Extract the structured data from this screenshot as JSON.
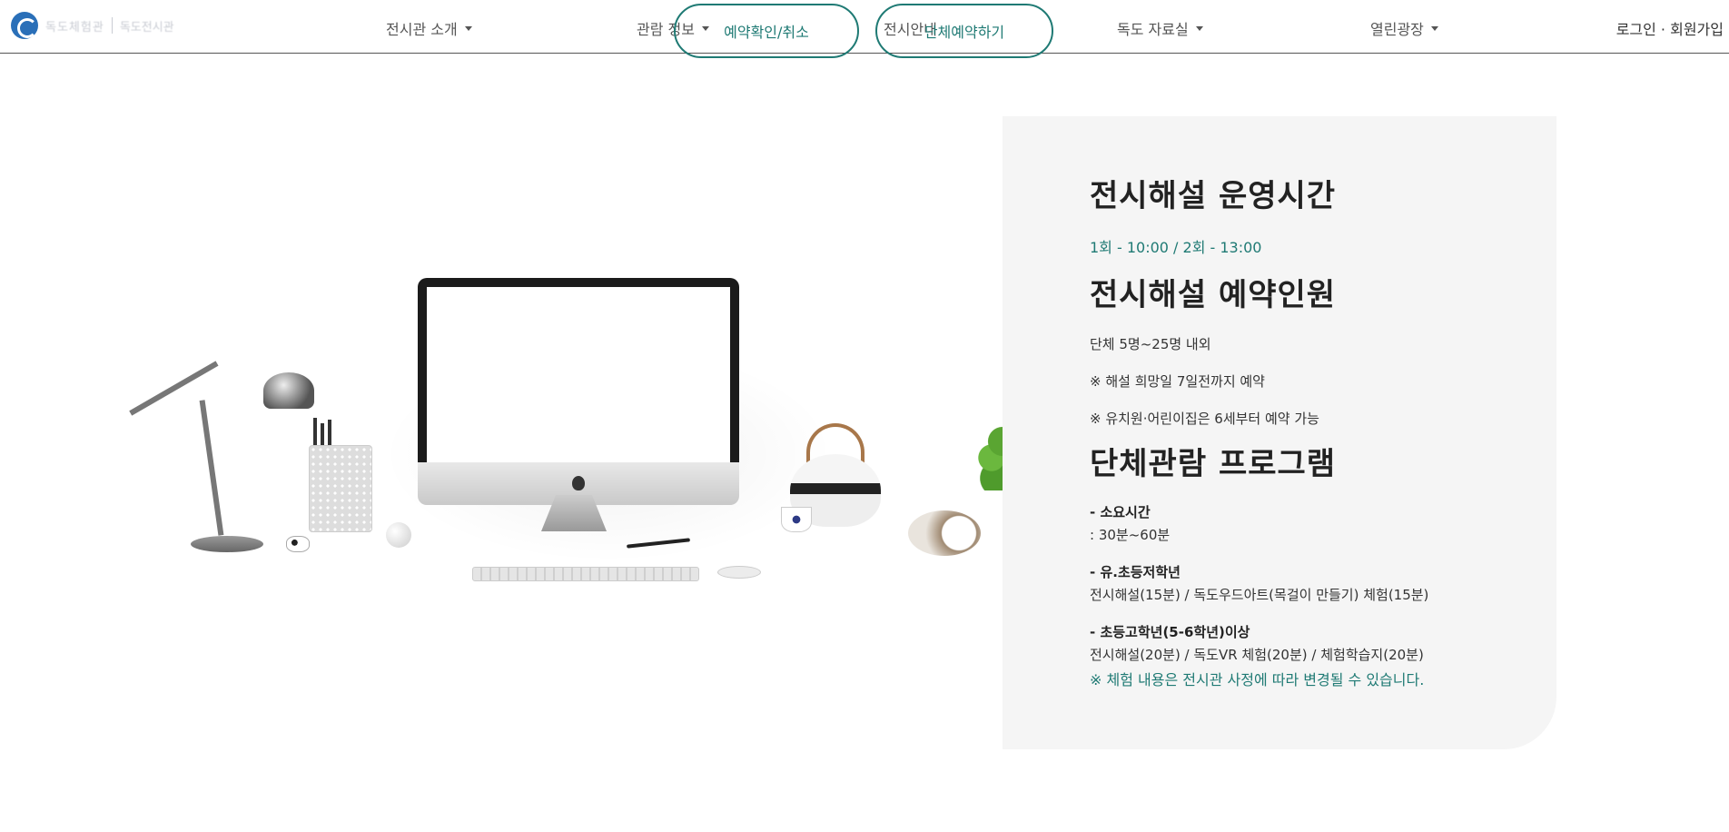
{
  "header": {
    "logo_text": "독도체험관",
    "logo_sub": "독도전시관",
    "nav": [
      {
        "label": "전시관 소개"
      },
      {
        "label": "관람 정보"
      },
      {
        "label": "전시안내"
      },
      {
        "label": "독도 자료실"
      },
      {
        "label": "열린광장"
      }
    ],
    "buttons": {
      "reservation_check": "예약확인/취소",
      "group_reservation": "단체예약하기"
    },
    "login": "로그인 · 회원가입"
  },
  "panel": {
    "section1_title": "전시해설 운영시간",
    "section1_time": "1회 - 10:00 / 2회 - 13:00",
    "section2_title": "전시해설 예약인원",
    "section2_line1": "단체 5명~25명 내외",
    "section2_note1": "※ 해설 희망일 7일전까지 예약",
    "section2_note2": "※ 유치원·어린이집은 6세부터 예약 가능",
    "section3_title": "단체관람 프로그램",
    "duration_label": "- 소요시간",
    "duration_value": ": 30분~60분",
    "elem_label": "- 유.초등저학년",
    "elem_value": "전시해설(15분) / 독도우드아트(목걸이 만들기) 체험(15분)",
    "upper_label": "- 초등고학년(5-6학년)이상",
    "upper_value": "전시해설(20분) / 독도VR 체험(20분) / 체험학습지(20분)",
    "notice": "※ 체험 내용은 전시관 사정에 따라 변경될 수 있습니다."
  },
  "colors": {
    "accent": "#1f7a74",
    "panel_bg": "#f5f5f5"
  }
}
